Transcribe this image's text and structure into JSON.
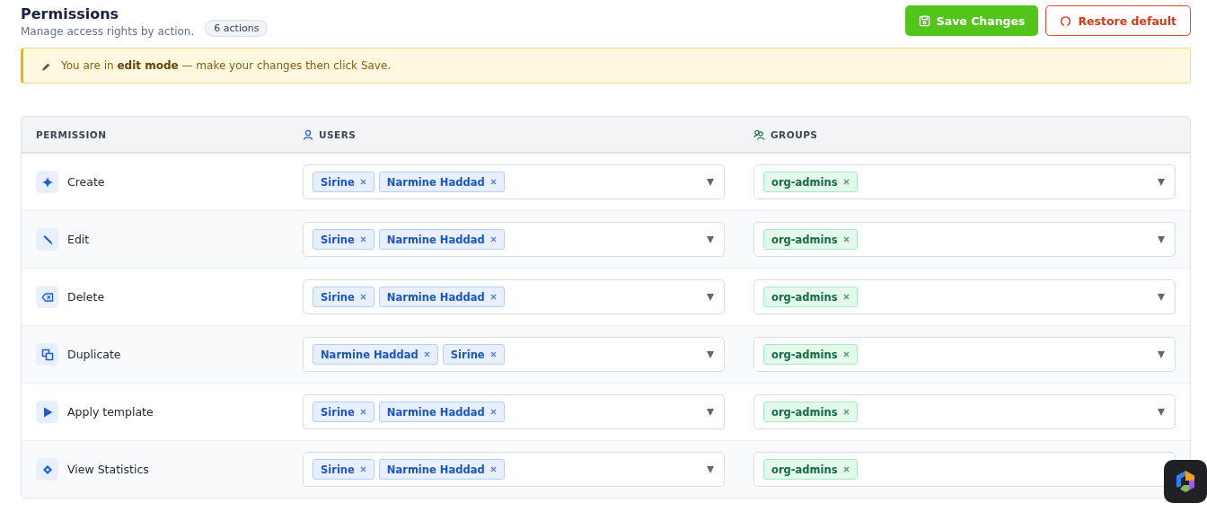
{
  "header": {
    "title": "Permissions",
    "subtitle": "Manage access rights by action.",
    "count_badge": "6 actions"
  },
  "buttons": {
    "save": "Save Changes",
    "restore": "Restore default"
  },
  "notice": "You are in **edit mode** — make your changes then click Save.",
  "table": {
    "columns": [
      "PERMISSION",
      "USERS",
      "GROUPS"
    ],
    "rows": [
      {
        "name": "Create",
        "users": [
          "Sirine",
          "Narmine Haddad"
        ],
        "groups": [
          "org-admins"
        ]
      },
      {
        "name": "Edit",
        "users": [
          "Sirine",
          "Narmine Haddad"
        ],
        "groups": [
          "org-admins"
        ]
      },
      {
        "name": "Delete",
        "users": [
          "Sirine",
          "Narmine Haddad"
        ],
        "groups": [
          "org-admins"
        ]
      },
      {
        "name": "Duplicate",
        "users": [
          "Narmine Haddad",
          "Sirine"
        ],
        "groups": [
          "org-admins"
        ]
      },
      {
        "name": "Apply template",
        "users": [
          "Sirine",
          "Narmine Haddad"
        ],
        "groups": [
          "org-admins"
        ]
      },
      {
        "name": "View Statistics",
        "users": [
          "Sirine",
          "Narmine Haddad"
        ],
        "groups": [
          "org-admins"
        ]
      }
    ]
  },
  "floating_app_button": {
    "kind": "app"
  }
}
